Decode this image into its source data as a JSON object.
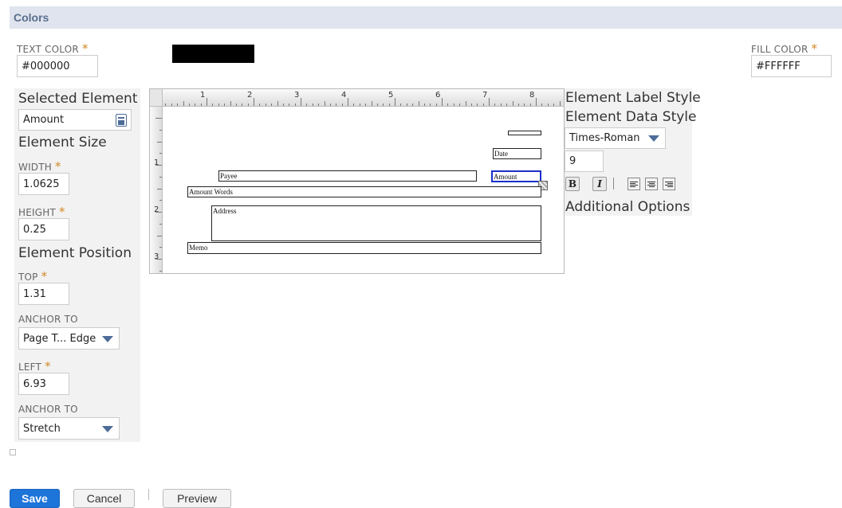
{
  "section": {
    "title": "Colors"
  },
  "text_color": {
    "label": "TEXT COLOR",
    "required": "*",
    "value": "#000000"
  },
  "fill_color": {
    "label": "FILL COLOR",
    "required": "*",
    "value": "#FFFFFF"
  },
  "left": {
    "selected_element_heading": "Selected Element",
    "selected_element_value": "Amount",
    "element_size_heading": "Element Size",
    "width": {
      "label": "WIDTH",
      "required": "*",
      "value": "1.0625"
    },
    "height": {
      "label": "HEIGHT",
      "required": "*",
      "value": "0.25"
    },
    "element_position_heading": "Element Position",
    "top": {
      "label": "TOP",
      "required": "*",
      "value": "1.31"
    },
    "anchor_to_1": {
      "label": "ANCHOR TO",
      "value": "Page T... Edge"
    },
    "left_field": {
      "label": "LEFT",
      "required": "*",
      "value": "6.93"
    },
    "anchor_to_2": {
      "label": "ANCHOR TO",
      "value": "Stretch"
    }
  },
  "canvas": {
    "ruler_top_numbers": [
      "1",
      "2",
      "3",
      "4",
      "5",
      "6",
      "7",
      "8"
    ],
    "ruler_left_numbers": [
      "1",
      "2",
      "3"
    ],
    "elements": {
      "date": "Date",
      "payee": "Payee",
      "amount": "Amount",
      "amount_words": "Amount Words",
      "address": "Address",
      "memo": "Memo"
    }
  },
  "right": {
    "element_label_style": "Element Label Style",
    "element_data_style": "Element Data Style",
    "font_value": "Times-Roman",
    "font_size_value": "9",
    "bold_label": "B",
    "italic_label": "I",
    "additional_options": "Additional Options"
  },
  "buttons": {
    "save": "Save",
    "cancel": "Cancel",
    "preview": "Preview"
  },
  "colors": {
    "accent": "#d28928",
    "primary_button": "#1d74d9",
    "section_bar": "#dfe4ee",
    "selected_outline": "#1a2fc9"
  }
}
